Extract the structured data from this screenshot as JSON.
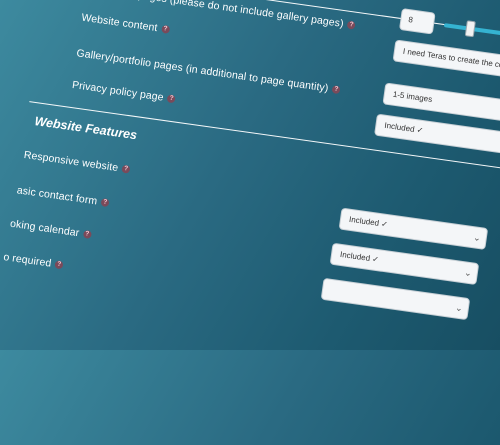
{
  "form": {
    "number_of_pages": {
      "label": "Number of pages (please do not include gallery pages)"
    },
    "website_content": {
      "label": "Website content",
      "value": "8"
    },
    "gallery_pages": {
      "label": "Gallery/portfolio pages (in additional to page quantity)",
      "value": "I need Teras to create the content"
    },
    "privacy_policy": {
      "label": "Privacy policy page",
      "value": "1-5 images",
      "extra_value": "Included ✓"
    }
  },
  "features": {
    "title": "Website Features",
    "responsive": {
      "label": "Responsive website"
    },
    "contact_form": {
      "label": "asic contact form",
      "value": "Included ✓"
    },
    "booking_calendar": {
      "label": "oking calendar",
      "value": "Included ✓"
    },
    "required": {
      "label": "o required"
    }
  },
  "help_icon": "?",
  "chevron": "⌄",
  "colors": {
    "slider": "#35b3d1",
    "help": "#7a4a5a"
  }
}
